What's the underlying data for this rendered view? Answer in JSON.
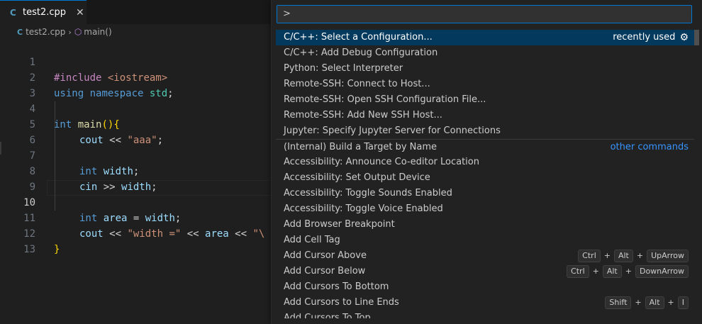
{
  "tab": {
    "icon": "C",
    "label": "test2.cpp",
    "close": "✕"
  },
  "breadcrumb": {
    "file_icon": "C",
    "file": "test2.cpp",
    "sep": "›",
    "symbol_icon": "⬡",
    "symbol": "main()"
  },
  "code_lines": [
    {
      "n": "1"
    },
    {
      "n": "2"
    },
    {
      "n": "3"
    },
    {
      "n": "4"
    },
    {
      "n": "5"
    },
    {
      "n": "6"
    },
    {
      "n": "7"
    },
    {
      "n": "8"
    },
    {
      "n": "9"
    },
    {
      "n": "10"
    },
    {
      "n": "11"
    },
    {
      "n": "12"
    },
    {
      "n": "13"
    }
  ],
  "code": {
    "l1a": "#include",
    "l1b": " <iostream>",
    "l2a": "using",
    "l2b": " namespace",
    "l2c": " std",
    "l2d": ";",
    "l4a": "int",
    "l4b": " main",
    "l4c": "()",
    "l4d": "{",
    "l5a": "cout",
    "l5b": " << ",
    "l5c": "\"aaa\"",
    "l5d": ";",
    "l7a": "int",
    "l7b": " width",
    "l7c": ";",
    "l8a": "cin",
    "l8b": " >> ",
    "l8c": "width",
    "l8d": ";",
    "l10a": "int",
    "l10b": " area",
    "l10c": " = ",
    "l10d": "width",
    "l10e": ";",
    "l11a": "cout",
    "l11b": " << ",
    "l11c": "\"width =\"",
    "l11d": " << ",
    "l11e": "area",
    "l11f": " << ",
    "l11g": "\"\\",
    "l12a": "}"
  },
  "palette": {
    "input_value": ">",
    "recently_used": "recently used",
    "other_commands": "other commands",
    "items": [
      "C/C++: Select a Configuration...",
      "C/C++: Add Debug Configuration",
      "Python: Select Interpreter",
      "Remote-SSH: Connect to Host...",
      "Remote-SSH: Open SSH Configuration File...",
      "Remote-SSH: Add New SSH Host...",
      "Jupyter: Specify Jupyter Server for Connections",
      "(Internal) Build a Target by Name",
      "Accessibility: Announce Co-editor Location",
      "Accessibility: Set Output Device",
      "Accessibility: Toggle Sounds Enabled",
      "Accessibility: Toggle Voice Enabled",
      "Add Browser Breakpoint",
      "Add Cell Tag",
      "Add Cursor Above",
      "Add Cursor Below",
      "Add Cursors To Bottom",
      "Add Cursors to Line Ends",
      "Add Cursors To Top"
    ],
    "keys": {
      "above": [
        "Ctrl",
        "Alt",
        "UpArrow"
      ],
      "below": [
        "Ctrl",
        "Alt",
        "DownArrow"
      ],
      "line_ends": [
        "Shift",
        "Alt",
        "I"
      ],
      "plus": "+"
    }
  }
}
